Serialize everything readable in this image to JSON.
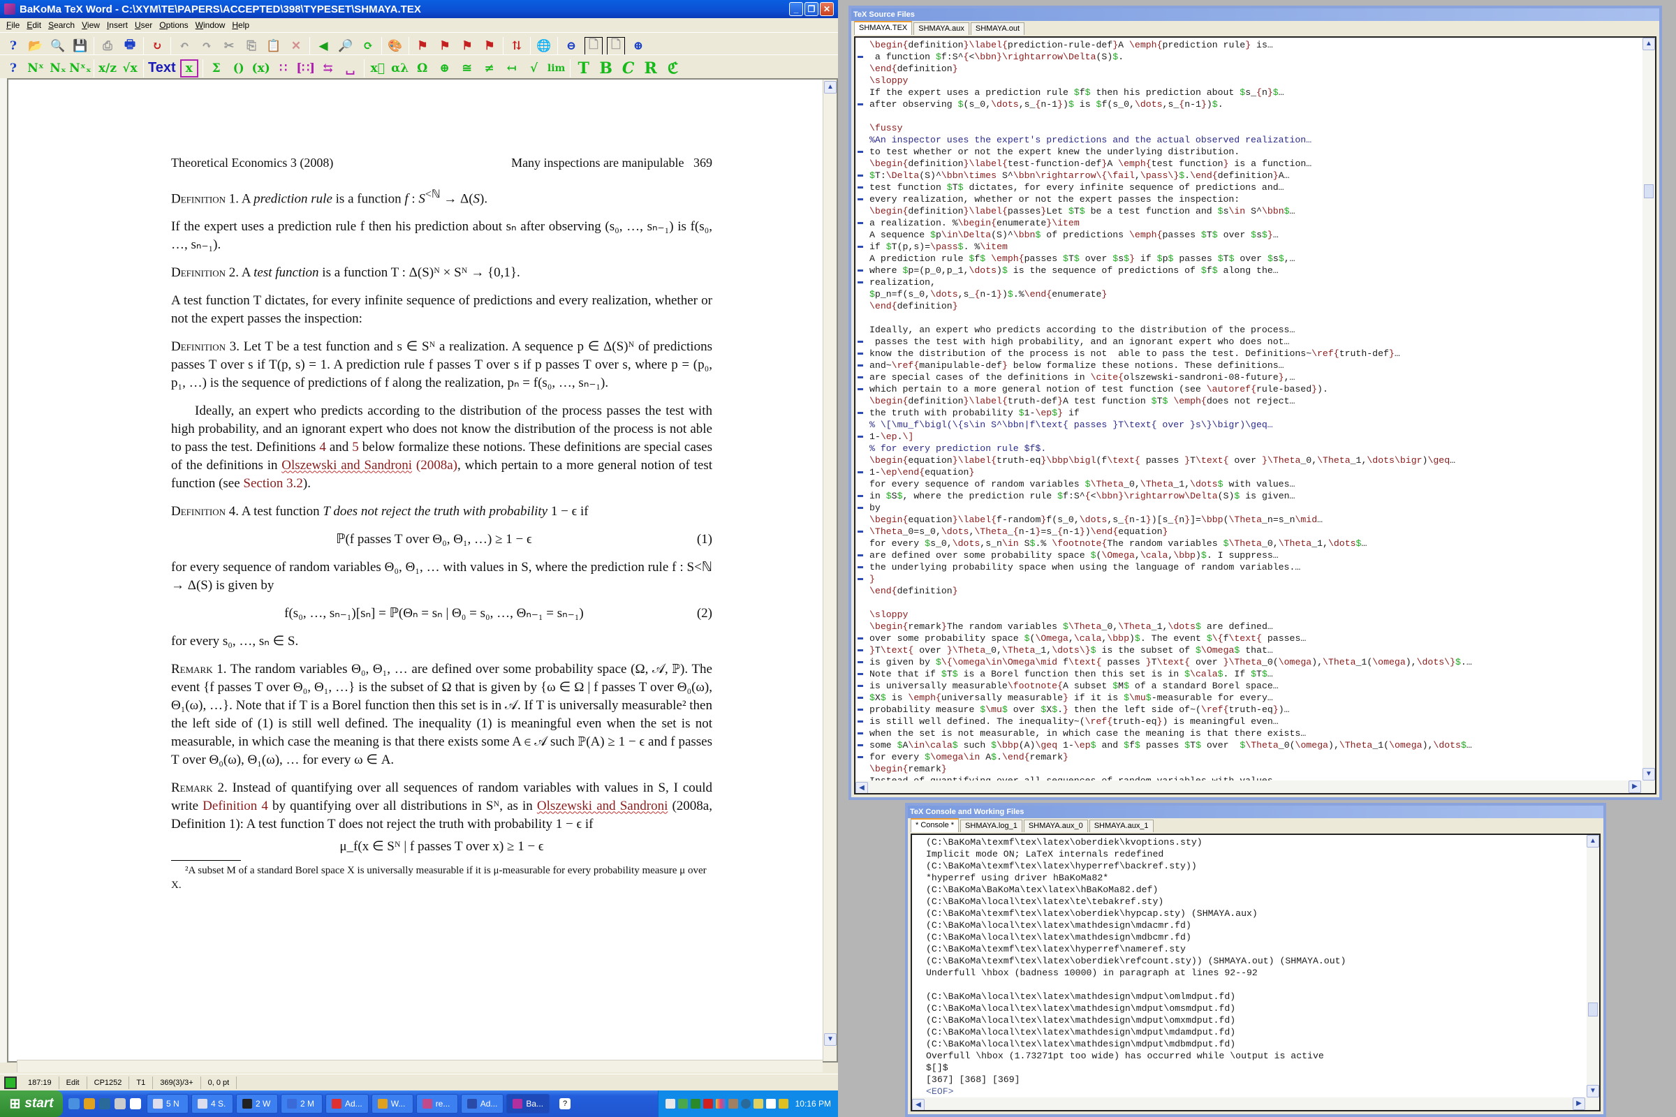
{
  "main_window": {
    "title": "BaKoMa TeX Word - C:\\XYM\\TE\\PAPERS\\ACCEPTED\\398\\TYPESET\\SHMAYA.TEX",
    "menu": [
      "File",
      "Edit",
      "Search",
      "View",
      "Insert",
      "User",
      "Options",
      "Window",
      "Help"
    ],
    "toolbar1_icons": [
      "help-icon",
      "open-icon",
      "browse-icon",
      "save-icon",
      "print-preview-icon",
      "print-icon",
      "typeset-icon",
      "undo-icon",
      "redo-icon",
      "cut-icon",
      "copy-icon",
      "paste-icon",
      "delete-icon",
      "back-icon",
      "find-icon",
      "refresh-icon",
      "palette-icon",
      "flag-icon",
      "flag-link-icon",
      "flag-back-icon",
      "flag-link2-icon",
      "sort-icon",
      "globe-link-icon",
      "zoom-out-icon",
      "page-width-icon",
      "full-page-icon",
      "zoom-in-icon"
    ],
    "toolbar2": {
      "items": [
        "?",
        "Nˣ",
        "Nₓ",
        "Nˣₓ",
        "x/z",
        "√x",
        "Text",
        "x",
        "Σ",
        "()",
        "(x)",
        "∷",
        "[∷]",
        "⇆",
        "␣",
        "x⃗",
        "αλ",
        "Ω",
        "⊕",
        "≅",
        "≠",
        "↤",
        "√",
        "lim",
        "T",
        "B",
        "C",
        "R",
        "ℭ"
      ],
      "text_label": "Text"
    },
    "page": {
      "running_head_left": "Theoretical Economics 3 (2008)",
      "running_head_right": "Many inspections are manipulable",
      "page_number": "369",
      "def1_label": "Definition 1.",
      "def1_pre": "A ",
      "def1_em": "prediction rule",
      "def1_post": " is a function f : S<sup>&lt;ℕ</sup> → Δ(S).",
      "para1": "If the expert uses a prediction rule f then his prediction about sₙ after observing (s₀, …, sₙ₋₁) is f(s₀, …, sₙ₋₁).",
      "def2_label": "Definition 2.",
      "def2_pre": "A ",
      "def2_em": "test function",
      "def2_post": " is a function T : Δ(S)ᴺ × Sᴺ → {0,1}.",
      "para2": "A test function T dictates, for every infinite sequence of predictions and every realization, whether or not the expert passes the inspection:",
      "def3_label": "Definition 3.",
      "def3_text": "Let T be a test function and s ∈ Sᴺ a realization. A sequence p ∈ Δ(S)ᴺ of predictions passes T over s if T(p, s) = 1. A prediction rule f passes T over s if p passes T over s, where p = (p₀, p₁, …) is the sequence of predictions of f along the realization, pₙ = f(s₀, …, sₙ₋₁).",
      "para3_a": "Ideally, an expert who predicts according to the distribution of the process passes the test with high probability, and an ignorant expert who does not know the distribution of the process is not able to pass the test. Definitions ",
      "para3_ref4": "4",
      "para3_b": " and ",
      "para3_ref5": "5",
      "para3_c": " below formalize these notions. These definitions are special cases of the definitions in ",
      "para3_cite": "Olszewski and Sandroni",
      "para3_cite_year": " (2008a)",
      "para3_d": ", which pertain to a more general notion of test function (see ",
      "para3_sec": "Section 3.2",
      "para3_e": ").",
      "def4_label": "Definition 4.",
      "def4_pre": "A test function ",
      "def4_em": "T does not reject the truth with probability",
      "def4_post": " 1 − ϵ if",
      "eq1": "ℙ(f passes T over Θ₀, Θ₁, …) ≥ 1 − ϵ",
      "eq1_num": "(1)",
      "para4": "for every sequence of random variables Θ₀, Θ₁, … with values in S, where the prediction rule f : S<ℕ → Δ(S) is given by",
      "eq2": "f(s₀, …, sₙ₋₁)[sₙ] = ℙ(Θₙ = sₙ | Θ₀ = s₀, …, Θₙ₋₁ = sₙ₋₁)",
      "eq2_num": "(2)",
      "para5": "for every s₀, …, sₙ ∈ S.",
      "rem1_label": "Remark 1.",
      "rem1_text": "The random variables Θ₀, Θ₁, … are defined over some probability space (Ω, 𝒜, ℙ). The event {f passes T over Θ₀, Θ₁, …} is the subset of Ω that is given by {ω ∈ Ω | f passes T over Θ₀(ω), Θ₁(ω), …}. Note that if T is a Borel function then this set is in 𝒜. If T is universally measurable² then the left side of (1) is still well defined. The inequality (1) is meaningful even when the set is not measurable, in which case the meaning is that there exists some A ∈ 𝒜 such ℙ(A) ≥ 1 − ϵ and f passes T over Θ₀(ω), Θ₁(ω), … for every ω ∈ A.",
      "rem2_label": "Remark 2.",
      "rem2_a": "Instead of quantifying over all sequences of random variables with values in S, I could write ",
      "rem2_ref": "Definition 4",
      "rem2_b": " by quantifying over all distributions in Sᴺ, as in ",
      "rem2_cite": "Olszewski and Sandroni",
      "rem2_c": " (2008a, Definition 1): A test function T does not reject the truth with probability 1 − ϵ if",
      "eq3": "μ_f(x ∈ Sᴺ | f passes T over x) ≥ 1 − ϵ",
      "footnote": "²A subset M of a standard Borel space X is universally measurable if it is μ-measurable for every probability measure μ over X."
    },
    "status": {
      "position": "187:19",
      "mode": "Edit",
      "codepage": "CP1252",
      "encoding": "T1",
      "page_info": "369(3)/3+",
      "coords": "0,  0 pt"
    }
  },
  "taskbar": {
    "start_label": "start",
    "tasks": [
      {
        "label": "5 N",
        "icon": "netscape-icon"
      },
      {
        "label": "4 S.",
        "icon": "explorer-icon"
      },
      {
        "label": "2 W",
        "icon": "cmd-icon"
      },
      {
        "label": "2 M",
        "icon": "word-icon"
      },
      {
        "label": "Ad...",
        "icon": "acrobat-icon"
      },
      {
        "label": "W...",
        "icon": "winamp-icon"
      },
      {
        "label": "re...",
        "icon": "recycle-icon"
      },
      {
        "label": "Ad...",
        "icon": "photoshop-icon"
      },
      {
        "label": "Ba...",
        "icon": "bakoma-icon",
        "active": true
      }
    ],
    "clock": "10:16 PM"
  },
  "source_window": {
    "title": "TeX Source Files",
    "tabs": [
      "SHMAYA.TEX",
      "SHMAYA.aux",
      "SHMAYA.out"
    ],
    "lines": [
      {
        "c": false,
        "t": "\\begin{definition}\\label{prediction-rule-def}A \\emph{prediction rule} is…"
      },
      {
        "c": true,
        "t": " a function $f:S^{<\\bbn}\\rightarrow\\Delta(S)$."
      },
      {
        "c": false,
        "t": "\\end{definition}"
      },
      {
        "c": false,
        "t": "\\sloppy"
      },
      {
        "c": false,
        "t": "If the expert uses a prediction rule $f$ then his prediction about $s_{n}$…"
      },
      {
        "c": true,
        "t": "after observing $(s_0,\\dots,s_{n-1})$ is $f(s_0,\\dots,s_{n-1})$."
      },
      {
        "c": false,
        "t": ""
      },
      {
        "c": false,
        "t": "\\fussy"
      },
      {
        "c": false,
        "t": "%An inspector uses the expert's predictions and the actual observed realization…"
      },
      {
        "c": true,
        "t": "to test whether or not the expert knew the underlying distribution."
      },
      {
        "c": false,
        "t": "\\begin{definition}\\label{test-function-def}A \\emph{test function} is a function…"
      },
      {
        "c": true,
        "t": "$T:\\Delta(S)^\\bbn\\times S^\\bbn\\rightarrow\\{\\fail,\\pass\\}$.\\end{definition}A…"
      },
      {
        "c": true,
        "t": "test function $T$ dictates, for every infinite sequence of predictions and…"
      },
      {
        "c": true,
        "t": "every realization, whether or not the expert passes the inspection:"
      },
      {
        "c": false,
        "t": "\\begin{definition}\\label{passes}Let $T$ be a test function and $s\\in S^\\bbn$…"
      },
      {
        "c": true,
        "t": "a realization. %\\begin{enumerate}\\item"
      },
      {
        "c": false,
        "t": "A sequence $p\\in\\Delta(S)^\\bbn$ of predictions \\emph{passes $T$ over $s$}…"
      },
      {
        "c": true,
        "t": "if $T(p,s)=\\pass$. %\\item"
      },
      {
        "c": false,
        "t": "A prediction rule $f$ \\emph{passes $T$ over $s$} if $p$ passes $T$ over $s$,…"
      },
      {
        "c": true,
        "t": "where $p=(p_0,p_1,\\dots)$ is the sequence of predictions of $f$ along the…"
      },
      {
        "c": true,
        "t": "realization,"
      },
      {
        "c": false,
        "t": "$p_n=f(s_0,\\dots,s_{n-1})$.%\\end{enumerate}"
      },
      {
        "c": false,
        "t": "\\end{definition}"
      },
      {
        "c": false,
        "t": ""
      },
      {
        "c": false,
        "t": "Ideally, an expert who predicts according to the distribution of the process…"
      },
      {
        "c": true,
        "t": " passes the test with high probability, and an ignorant expert who does not…"
      },
      {
        "c": true,
        "t": "know the distribution of the process is not  able to pass the test. Definitions~\\ref{truth-def}…"
      },
      {
        "c": true,
        "t": "and~\\ref{manipulable-def} below formalize these notions. These definitions…"
      },
      {
        "c": true,
        "t": "are special cases of the definitions in \\cite{olszewski-sandroni-08-future},…"
      },
      {
        "c": true,
        "t": "which pertain to a more general notion of test function (see \\autoref{rule-based})."
      },
      {
        "c": false,
        "t": "\\begin{definition}\\label{truth-def}A test function $T$ \\emph{does not reject…"
      },
      {
        "c": true,
        "t": "the truth with probability $1-\\ep$} if"
      },
      {
        "c": false,
        "t": "% \\[\\mu_f\\bigl(\\{s\\in S^\\bbn|f\\text{ passes }T\\text{ over }s\\}\\bigr)\\geq…"
      },
      {
        "c": true,
        "t": "1-\\ep.\\]"
      },
      {
        "c": false,
        "t": "% for every prediction rule $f$."
      },
      {
        "c": false,
        "t": "\\begin{equation}\\label{truth-eq}\\bbp\\bigl(f\\text{ passes }T\\text{ over }\\Theta_0,\\Theta_1,\\dots\\bigr)\\geq…"
      },
      {
        "c": true,
        "t": "1-\\ep\\end{equation}"
      },
      {
        "c": false,
        "t": "for every sequence of random variables $\\Theta_0,\\Theta_1,\\dots$ with values…"
      },
      {
        "c": true,
        "t": "in $S$, where the prediction rule $f:S^{<\\bbn}\\rightarrow\\Delta(S)$ is given…"
      },
      {
        "c": true,
        "t": "by"
      },
      {
        "c": false,
        "t": "\\begin{equation}\\label{f-random}f(s_0,\\dots,s_{n-1})[s_{n}]=\\bbp(\\Theta_n=s_n\\mid…"
      },
      {
        "c": true,
        "t": "\\Theta_0=s_0,\\dots,\\Theta_{n-1}=s_{n-1})\\end{equation}"
      },
      {
        "c": false,
        "t": "for every $s_0,\\dots,s_n\\in S$.% \\footnote{The random variables $\\Theta_0,\\Theta_1,\\dots$…"
      },
      {
        "c": true,
        "t": "are defined over some probability space $(\\Omega,\\cala,\\bbp)$. I suppress…"
      },
      {
        "c": true,
        "t": "the underlying probability space when using the language of random variables.…"
      },
      {
        "c": true,
        "t": "}"
      },
      {
        "c": false,
        "t": "\\end{definition}"
      },
      {
        "c": false,
        "t": ""
      },
      {
        "c": false,
        "t": "\\sloppy"
      },
      {
        "c": false,
        "t": "\\begin{remark}The random variables $\\Theta_0,\\Theta_1,\\dots$ are defined…"
      },
      {
        "c": true,
        "t": "over some probability space $(\\Omega,\\cala,\\bbp)$. The event $\\{f\\text{ passes…"
      },
      {
        "c": true,
        "t": "}T\\text{ over }\\Theta_0,\\Theta_1,\\dots\\}$ is the subset of $\\Omega$ that…"
      },
      {
        "c": true,
        "t": "is given by $\\{\\omega\\in\\Omega\\mid f\\text{ passes }T\\text{ over }\\Theta_0(\\omega),\\Theta_1(\\omega),\\dots\\}$.…"
      },
      {
        "c": true,
        "t": "Note that if $T$ is a Borel function then this set is in $\\cala$. If $T$…"
      },
      {
        "c": true,
        "t": "is universally measurable\\footnote{A subset $M$ of a standard Borel space…"
      },
      {
        "c": true,
        "t": "$X$ is \\emph{universally measurable} if it is $\\mu$-measurable for every…"
      },
      {
        "c": true,
        "t": "probability measure $\\mu$ over $X$.} then the left side of~(\\ref{truth-eq})…"
      },
      {
        "c": true,
        "t": "is still well defined. The inequality~(\\ref{truth-eq}) is meaningful even…"
      },
      {
        "c": true,
        "t": "when the set is not measurable, in which case the meaning is that there exists…"
      },
      {
        "c": true,
        "t": "some $A\\in\\cala$ such $\\bbp(A)\\geq 1-\\ep$ and $f$ passes $T$ over  $\\Theta_0(\\omega),\\Theta_1(\\omega),\\dots$…"
      },
      {
        "c": true,
        "t": "for every $\\omega\\in A$.\\end{remark}"
      },
      {
        "c": false,
        "t": "\\begin{remark}"
      },
      {
        "c": false,
        "t": "Instead of quantifying over all sequences of random variables with values…"
      }
    ]
  },
  "console_window": {
    "title": "TeX Console and Working Files",
    "tabs": [
      "* Console *",
      "SHMAYA.log_1",
      "SHMAYA.aux_0",
      "SHMAYA.aux_1"
    ],
    "lines": [
      "(C:\\BaKoMa\\texmf\\tex\\latex\\oberdiek\\kvoptions.sty)",
      "Implicit mode ON; LaTeX internals redefined",
      "(C:\\BaKoMa\\texmf\\tex\\latex\\hyperref\\backref.sty))",
      "*hyperref using driver hBaKoMa82*",
      "(C:\\BaKoMa\\BaKoMa\\tex\\latex\\hBaKoMa82.def)",
      "(C:\\BaKoMa\\local\\tex\\latex\\te\\tebakref.sty)",
      "(C:\\BaKoMa\\texmf\\tex\\latex\\oberdiek\\hypcap.sty) (SHMAYA.aux)",
      "(C:\\BaKoMa\\local\\tex\\latex\\mathdesign\\mdacmr.fd)",
      "(C:\\BaKoMa\\local\\tex\\latex\\mathdesign\\mdbcmr.fd)",
      "(C:\\BaKoMa\\texmf\\tex\\latex\\hyperref\\nameref.sty",
      "(C:\\BaKoMa\\texmf\\tex\\latex\\oberdiek\\refcount.sty)) (SHMAYA.out) (SHMAYA.out)",
      "Underfull \\hbox (badness 10000) in paragraph at lines 92--92",
      "",
      "(C:\\BaKoMa\\local\\tex\\latex\\mathdesign\\mdput\\omlmdput.fd)",
      "(C:\\BaKoMa\\local\\tex\\latex\\mathdesign\\mdput\\omsmdput.fd)",
      "(C:\\BaKoMa\\local\\tex\\latex\\mathdesign\\mdput\\omxmdput.fd)",
      "(C:\\BaKoMa\\local\\tex\\latex\\mathdesign\\mdput\\mdamdput.fd)",
      "(C:\\BaKoMa\\local\\tex\\latex\\mathdesign\\mdput\\mdbmdput.fd)",
      "Overfull \\hbox (1.73271pt too wide) has occurred while \\output is active",
      "$[]$",
      "[367] [368] [369]"
    ],
    "eof_marker": "<EOF>"
  }
}
